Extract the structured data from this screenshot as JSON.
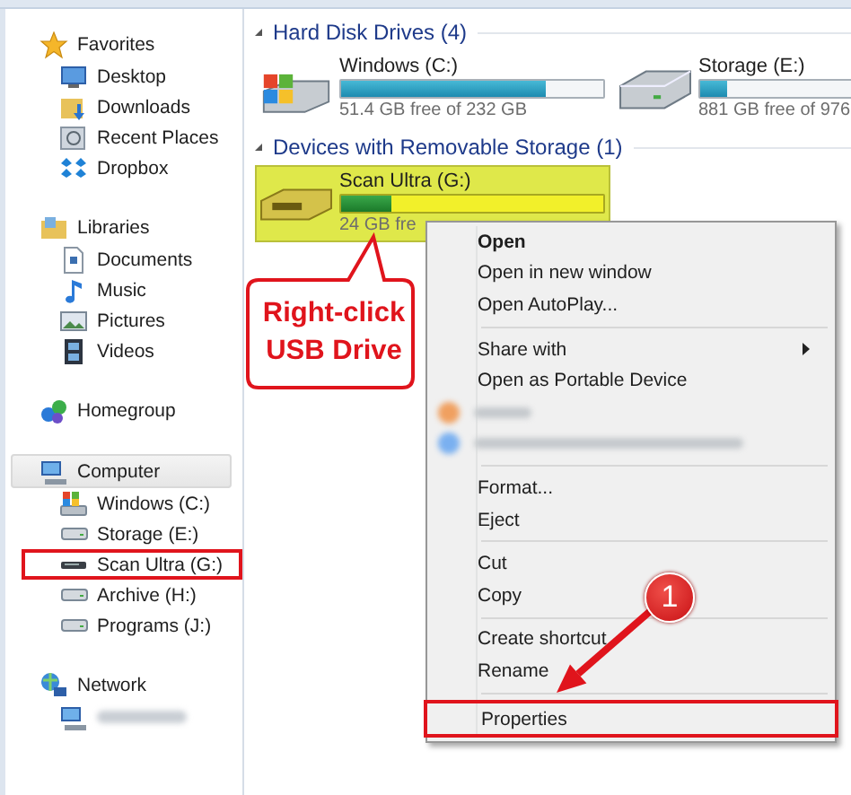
{
  "sidebar": {
    "groups": [
      {
        "label": "Favorites",
        "selected": false,
        "children": [
          {
            "label": "Desktop",
            "selected": false,
            "highlighted": false
          },
          {
            "label": "Downloads",
            "selected": false,
            "highlighted": false
          },
          {
            "label": "Recent Places",
            "selected": false,
            "highlighted": false
          },
          {
            "label": "Dropbox",
            "selected": false,
            "highlighted": false
          }
        ]
      },
      {
        "label": "Libraries",
        "selected": false,
        "children": [
          {
            "label": "Documents",
            "selected": false,
            "highlighted": false
          },
          {
            "label": "Music",
            "selected": false,
            "highlighted": false
          },
          {
            "label": "Pictures",
            "selected": false,
            "highlighted": false
          },
          {
            "label": "Videos",
            "selected": false,
            "highlighted": false
          }
        ]
      },
      {
        "label": "Homegroup",
        "selected": false
      },
      {
        "label": "Computer",
        "selected": true,
        "children": [
          {
            "label": "Windows (C:)",
            "selected": false,
            "highlighted": false
          },
          {
            "label": "Storage (E:)",
            "selected": false,
            "highlighted": false
          },
          {
            "label": "Scan Ultra (G:)",
            "selected": false,
            "highlighted": true
          },
          {
            "label": "Archive (H:)",
            "selected": false,
            "highlighted": false
          },
          {
            "label": "Programs (J:)",
            "selected": false,
            "highlighted": false
          }
        ]
      },
      {
        "label": "Network",
        "selected": false,
        "children": [
          {
            "kind": "blurred",
            "selected": false,
            "highlighted": false
          }
        ]
      }
    ]
  },
  "sections": [
    {
      "title": "Hard Disk Drives (4)",
      "drives": [
        {
          "name": "Windows (C:)",
          "level": 0.78,
          "free": "51.4 GB free of 232 GB",
          "selected": false
        },
        {
          "name": "Storage (E:)",
          "level": 0.1,
          "free": "881 GB free of 976",
          "selected": false
        }
      ]
    },
    {
      "title": "Devices with Removable Storage (1)",
      "drives": [
        {
          "name": "Scan Ultra (G:)",
          "level": 0.19,
          "free": "24 GB fre",
          "selected": true
        }
      ]
    }
  ],
  "context_menu": {
    "items": [
      {
        "kind": "item",
        "label": "Open",
        "default": true
      },
      {
        "kind": "item",
        "label": "Open in new window",
        "default": false
      },
      {
        "kind": "item",
        "label": "Open AutoPlay...",
        "default": false
      },
      {
        "kind": "separator"
      },
      {
        "kind": "submenu",
        "label": "Share with",
        "default": false
      },
      {
        "kind": "item",
        "label": "Open as Portable Device",
        "default": false
      },
      {
        "kind": "blurred"
      },
      {
        "kind": "blurred"
      },
      {
        "kind": "separator"
      },
      {
        "kind": "item",
        "label": "Format...",
        "default": false
      },
      {
        "kind": "item",
        "label": "Eject",
        "default": false
      },
      {
        "kind": "separator"
      },
      {
        "kind": "item",
        "label": "Cut",
        "default": false
      },
      {
        "kind": "item",
        "label": "Copy",
        "default": false
      },
      {
        "kind": "separator"
      },
      {
        "kind": "item",
        "label": "Create shortcut",
        "default": false
      },
      {
        "kind": "item",
        "label": "Rename",
        "default": false
      },
      {
        "kind": "separator"
      },
      {
        "kind": "item",
        "label": "Properties",
        "default": false,
        "highlighted": true
      }
    ]
  },
  "annotations": {
    "callout": "Right-click USB Drive",
    "step_badge": "1"
  }
}
